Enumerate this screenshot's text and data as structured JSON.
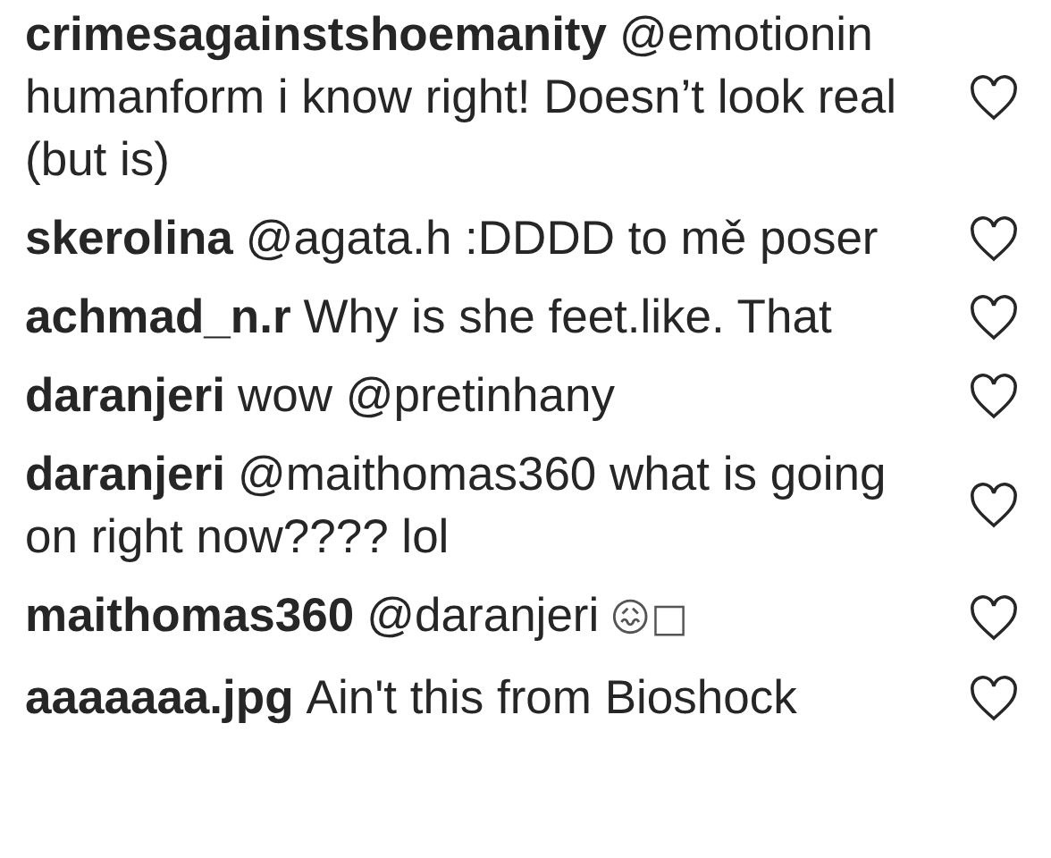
{
  "comments": [
    {
      "username": "crimesagainstshoemanity",
      "text": "@emotionin humanform i know right! Doesn’t look real (but is)",
      "liked": false
    },
    {
      "username": "skerolina",
      "text": "@agata.h :DDDD to mě poser",
      "liked": false
    },
    {
      "username": "achmad_n.r",
      "text": "Why is she feet.like. That",
      "liked": false
    },
    {
      "username": "daranjeri",
      "text": "wow @pretinhany",
      "liked": false
    },
    {
      "username": "daranjeri",
      "text": "@maithomas360 what is going on right now???? lol",
      "liked": false
    },
    {
      "username": "maithomas360",
      "text": "@daranjeri",
      "emoji": "😖□",
      "liked": false
    },
    {
      "username": "aaaaaaa.jpg",
      "text": "Ain't this from Bioshock",
      "liked": false
    }
  ]
}
